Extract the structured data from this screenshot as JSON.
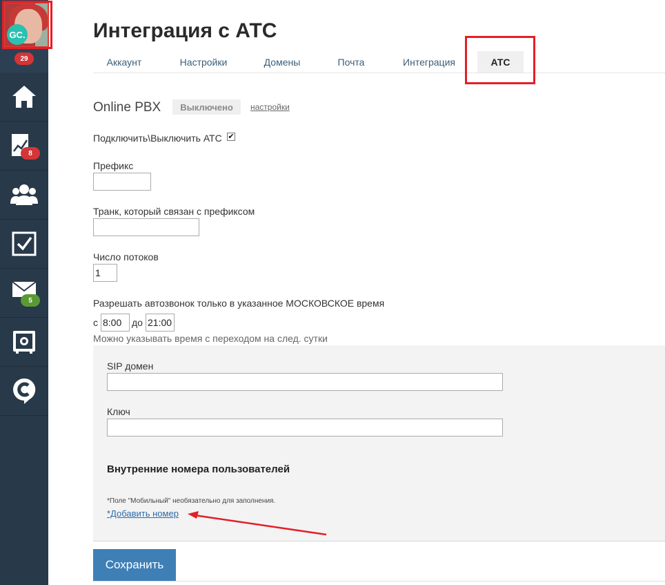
{
  "sidebar": {
    "avatar_initials": "GC.",
    "items": [
      {
        "name": "home",
        "icon": "home-icon",
        "badge": ""
      },
      {
        "name": "analytics",
        "icon": "chart-icon",
        "badge": "8",
        "badge_color": "#d43537"
      },
      {
        "name": "contacts",
        "icon": "users-icon",
        "badge": ""
      },
      {
        "name": "tasks",
        "icon": "checkbox-icon",
        "badge": ""
      },
      {
        "name": "mail",
        "icon": "mail-icon",
        "badge": "5",
        "badge_color": "#5a9a34"
      },
      {
        "name": "safe",
        "icon": "safe-icon",
        "badge": ""
      },
      {
        "name": "chat",
        "icon": "chat-icon",
        "badge": ""
      }
    ],
    "avatar_badge": "29",
    "colors": {
      "bg": "#28394a",
      "accent_red": "#d43537",
      "accent_green": "#5a9a34"
    }
  },
  "header": {
    "title": "Интеграция с АТС",
    "tabs": [
      {
        "label": "Аккаунт",
        "active": false
      },
      {
        "label": "Настройки",
        "active": false
      },
      {
        "label": "Домены",
        "active": false
      },
      {
        "label": "Почта",
        "active": false
      },
      {
        "label": "Интеграция",
        "active": false
      },
      {
        "label": "АТС",
        "active": true
      }
    ]
  },
  "form": {
    "pbx_name": "Online PBX",
    "status": "Выключено",
    "settings_link": "настройки",
    "toggle_label": "Подключить\\Выключить АТС",
    "toggle_checked": "✔",
    "prefix_label": "Префикс",
    "prefix_value": "",
    "trunk_label": "Транк, который связан с префиксом",
    "trunk_value": "",
    "streams_label": "Число потоков",
    "streams_value": "1",
    "autocall_label": "Разрешать автозвонок только в указанное МОСКОВСКОЕ время",
    "from_label": "с",
    "from_value": "8:00",
    "to_label": "до",
    "to_value": "21:00",
    "time_hint": "Можно указывать время с переходом на след. сутки"
  },
  "panel": {
    "sip_label": "SIP домен",
    "sip_value": "",
    "key_label": "Ключ",
    "key_value": "",
    "heading": "Внутренние номера пользователей",
    "note": "*Поле \"Мобильный\" необязательно для заполнения.",
    "add_link": "*Добавить номер"
  },
  "actions": {
    "save_label": "Сохранить",
    "save_color": "#3e7fb6"
  },
  "annotation_color": "#e41e26"
}
